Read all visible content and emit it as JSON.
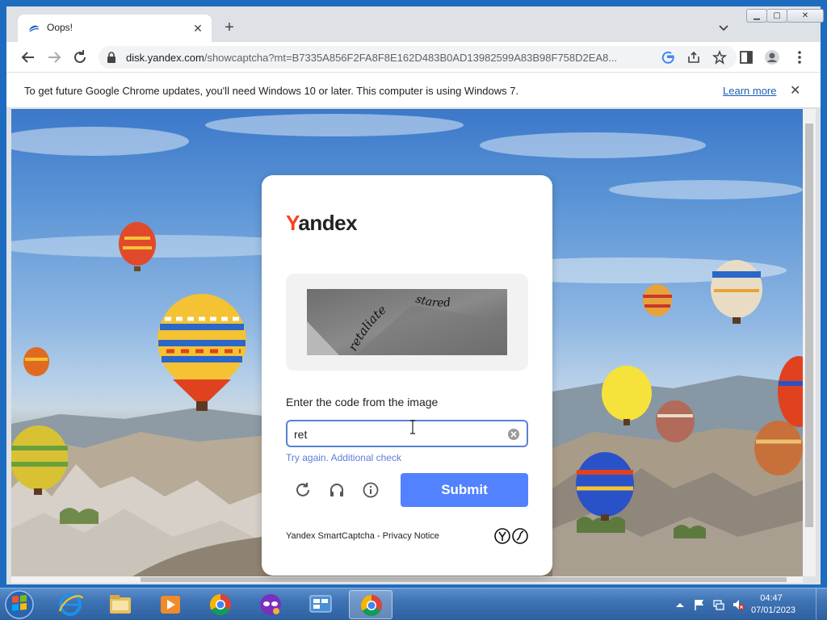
{
  "browser": {
    "tab": {
      "title": "Oops!",
      "favicon": "yandex-disk-icon"
    },
    "new_tab_label": "+",
    "url": {
      "host": "disk.yandex.com",
      "path": "/showcaptcha?mt=B7335A856F2FA8F8E162D483B0AD13982599A83B98F758D2EA8..."
    },
    "window_controls": [
      "minimize",
      "maximize",
      "close"
    ]
  },
  "infobar": {
    "message": "To get future Google Chrome updates, you'll need Windows 10 or later. This computer is using Windows 7.",
    "link": "Learn more"
  },
  "captcha": {
    "logo_first": "Y",
    "logo_rest": "andex",
    "image_words": [
      "retaliate",
      "stared"
    ],
    "prompt": "Enter the code from the image",
    "input_value": "ret",
    "status": "Try again. Additional check",
    "submit_label": "Submit",
    "footer": "Yandex SmartCaptcha - Privacy Notice",
    "icons": [
      "refresh-icon",
      "audio-headphones-icon",
      "info-icon"
    ]
  },
  "taskbar": {
    "apps": [
      "internet-explorer",
      "windows-explorer",
      "media-player",
      "chrome",
      "mask-app",
      "control-panel",
      "chrome-active"
    ],
    "time": "04:47",
    "date": "07/01/2023"
  },
  "colors": {
    "yandex_red": "#fc3f1d",
    "submit_blue": "#5282ff",
    "status_blue": "#5b7fd6"
  }
}
